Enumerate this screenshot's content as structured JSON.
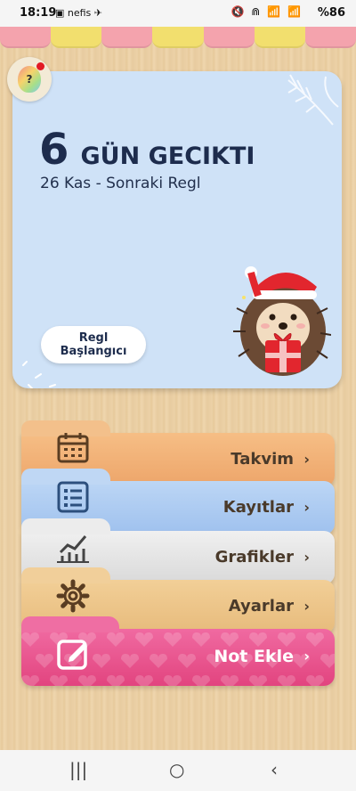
{
  "status_bar": {
    "time": "18:19",
    "left_icons": "▣ nefis ✈",
    "right_icons": "🔇 ⋒ 📶 📶",
    "battery": "%86",
    "battery_icon": "battery-icon"
  },
  "scallop_colors": [
    "#f4a3ad",
    "#f2df6e",
    "#f4a3ad",
    "#f2df6e",
    "#f4a3ad",
    "#f2df6e",
    "#f4a3ad"
  ],
  "help_button": {
    "symbol": "?",
    "badge_color": "#e21b24"
  },
  "card": {
    "days_number": "6",
    "days_text": "GÜN GECIKTI",
    "next_period": "26 Kas - Sonraki Regl",
    "start_button": "Regl Başlangıcı",
    "accent": "#1d2c4d"
  },
  "menu": [
    {
      "label": "Takvim",
      "icon": "calendar-icon"
    },
    {
      "label": "Kayıtlar",
      "icon": "list-icon"
    },
    {
      "label": "Grafikler",
      "icon": "chart-icon"
    },
    {
      "label": "Ayarlar",
      "icon": "gear-icon"
    },
    {
      "label": "Not Ekle",
      "icon": "edit-note-icon"
    }
  ],
  "chevron": "›",
  "nav": {
    "recent": "|||",
    "home": "○",
    "back": "‹"
  }
}
